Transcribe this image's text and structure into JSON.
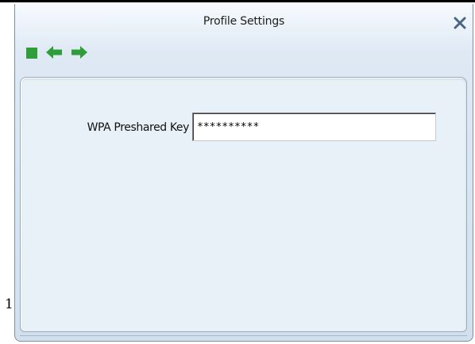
{
  "window": {
    "title": "Profile Settings"
  },
  "icons": {
    "close": "close-icon",
    "stop": "stop-icon",
    "back": "back-arrow-icon",
    "forward": "forward-arrow-icon"
  },
  "form": {
    "wpa_key": {
      "label": "WPA Preshared Key",
      "value": "**********"
    }
  },
  "margin_mark": "1",
  "colors": {
    "toolbar_green": "#2f9e3a",
    "close_blue": "#4b6584",
    "panel_background": "#e8f1f7",
    "window_background": "#dfe9f4"
  }
}
